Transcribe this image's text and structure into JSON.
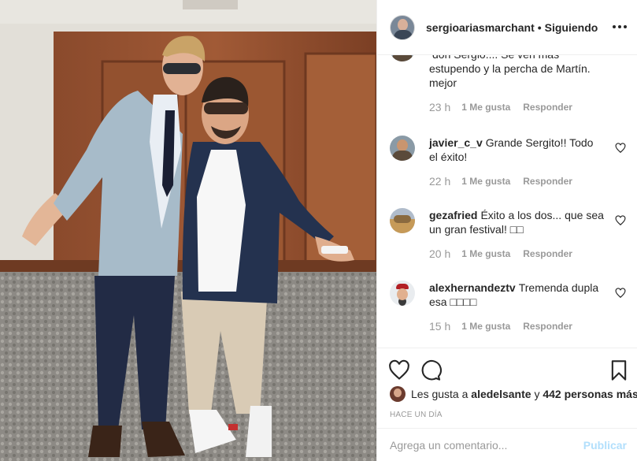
{
  "post": {
    "photo_alt": "",
    "username": "sergioariasmarchant",
    "separator": "•",
    "follow_state": "Siguiendo",
    "more_icon": "more-horizontal-icon"
  },
  "comments": [
    {
      "user": "",
      "text": "don Sergio.... Se ven más estupendo y la percha de Martín. mejor",
      "time": "23 h",
      "likes": "1 Me gusta",
      "reply": "Responder"
    },
    {
      "user": "javier_c_v",
      "text": "Grande Sergito!! Todo el éxito!",
      "time": "22 h",
      "likes": "1 Me gusta",
      "reply": "Responder"
    },
    {
      "user": "gezafried",
      "text": "Éxito a los dos... que sea un gran festival! □□",
      "time": "20 h",
      "likes": "1 Me gusta",
      "reply": "Responder"
    },
    {
      "user": "alexhernandeztv",
      "text": "Tremenda dupla esa □□□□",
      "time": "15 h",
      "likes": "1 Me gusta",
      "reply": "Responder"
    }
  ],
  "actions": {
    "like_icon": "heart-icon",
    "comment_icon": "comment-bubble-icon",
    "save_icon": "bookmark-icon"
  },
  "likes": {
    "prefix": "Les gusta a",
    "user": "aledelsante",
    "connector": "y",
    "others": "442 personas más"
  },
  "timestamp": "Hace un día",
  "composer": {
    "placeholder": "Agrega un comentario...",
    "publish": "Publicar"
  },
  "colors": {
    "accent": "#b2dffc",
    "text": "#262626",
    "muted": "#999999",
    "border": "#efefef"
  }
}
